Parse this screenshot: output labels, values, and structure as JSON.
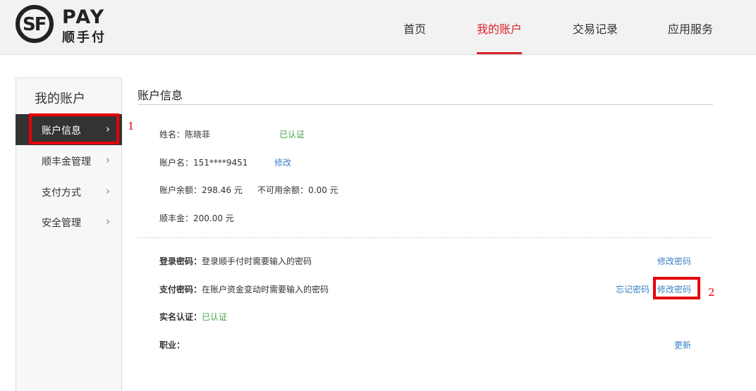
{
  "brand": {
    "pay": "PAY",
    "cn": "顺手付",
    "mark": "SF"
  },
  "nav": [
    {
      "label": "首页"
    },
    {
      "label": "我的账户"
    },
    {
      "label": "交易记录"
    },
    {
      "label": "应用服务"
    }
  ],
  "sidebar": {
    "title": "我的账户",
    "items": [
      {
        "label": "账户信息"
      },
      {
        "label": "顺丰金管理"
      },
      {
        "label": "支付方式"
      },
      {
        "label": "安全管理"
      }
    ]
  },
  "annotations": {
    "one": "1",
    "two": "2"
  },
  "main": {
    "title": "账户信息",
    "name_label": "姓名：陈晓菲",
    "name_status": "已认证",
    "account_label": "账户名：151****9451",
    "account_edit": "修改",
    "balance": "账户余额：298.46 元",
    "unavailable": "不可用余额：0.00 元",
    "sf_gold": "顺丰金：200.00 元",
    "login_pwd_label": "登录密码：",
    "login_pwd_desc": "登录顺手付时需要输入的密码",
    "login_pwd_link": "修改密码",
    "pay_pwd_label": "支付密码：",
    "pay_pwd_desc": "在账户资金变动时需要输入的密码",
    "pay_pwd_forgot": "忘记密码",
    "pay_pwd_link": "修改密码",
    "realname_label": "实名认证：",
    "realname_status": "已认证",
    "job_label": "职业：",
    "job_link": "更新"
  },
  "colors": {
    "accent": "#d9232b",
    "link": "#3a82c4",
    "verified": "#46a546",
    "annotation": "#e8000b"
  }
}
